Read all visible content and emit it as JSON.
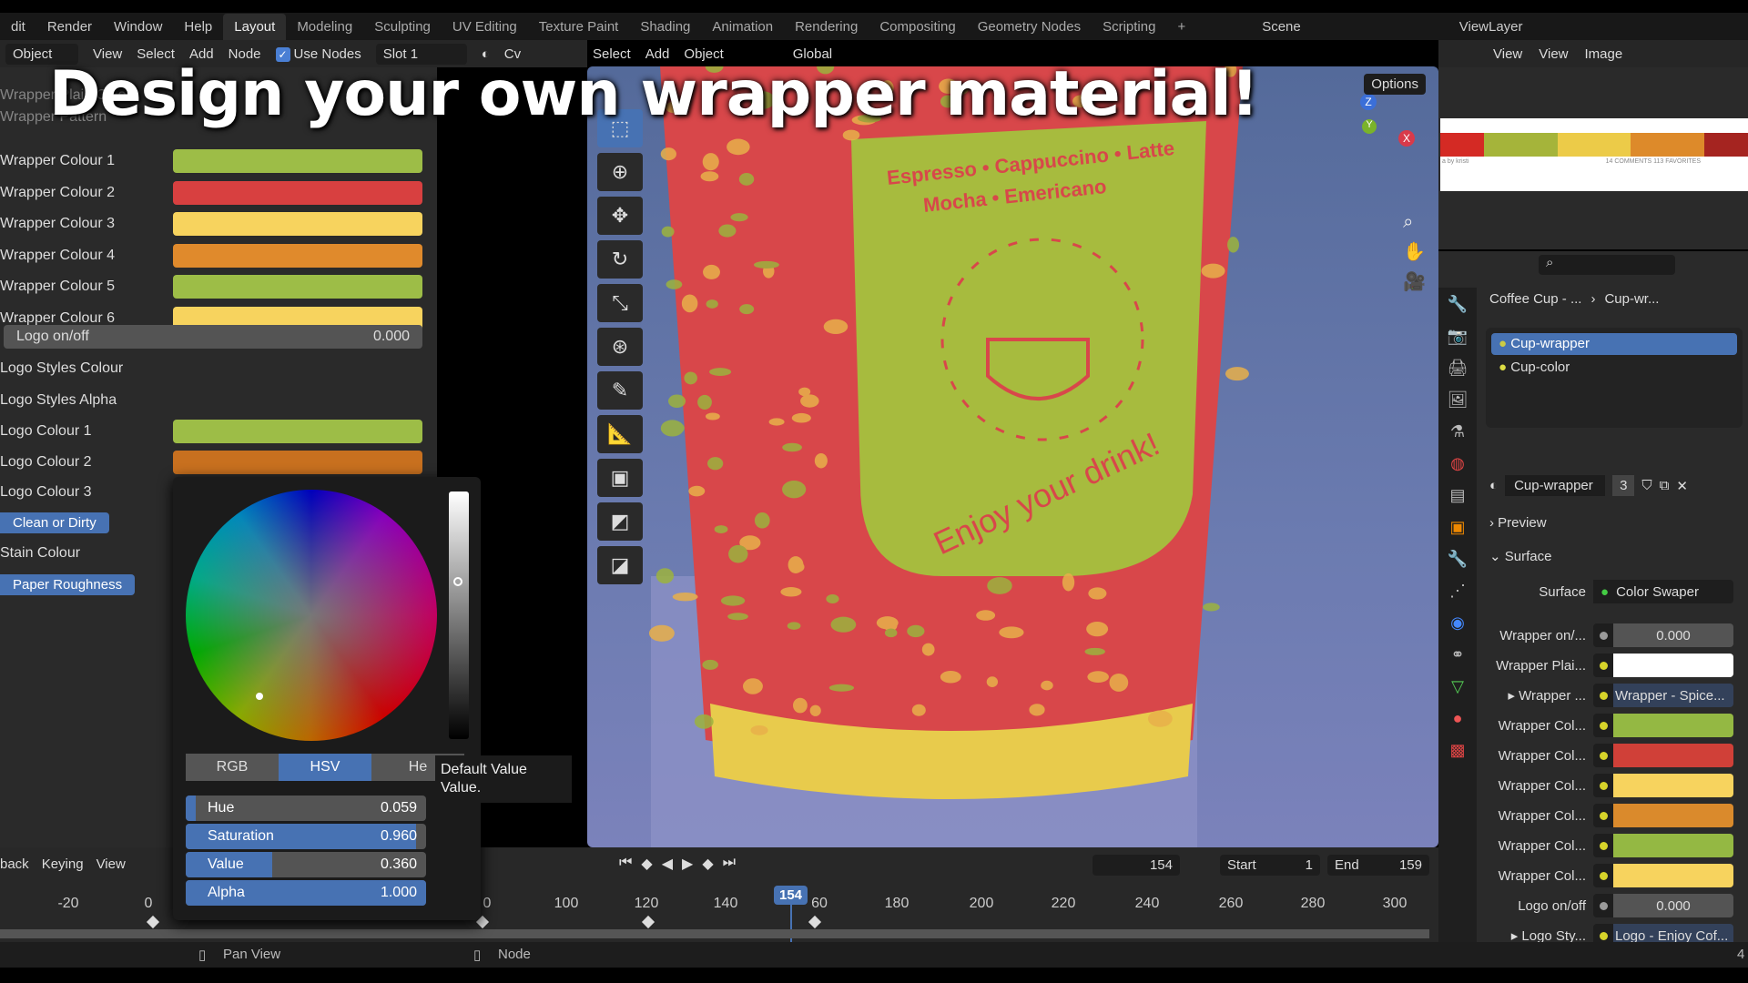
{
  "overlay_title": "Design your own wrapper material!",
  "topmenu": {
    "items": [
      "dit",
      "Render",
      "Window",
      "Help"
    ],
    "workspaces": [
      "Layout",
      "Modeling",
      "Sculpting",
      "UV Editing",
      "Texture Paint",
      "Shading",
      "Animation",
      "Rendering",
      "Compositing",
      "Geometry Nodes",
      "Scripting",
      "+"
    ],
    "active": "Layout",
    "scene": "Scene",
    "viewlayer": "ViewLayer"
  },
  "node_header": {
    "mode": "Object",
    "menus": [
      "View",
      "Select",
      "Add",
      "Node"
    ],
    "use_nodes": "Use Nodes",
    "slot": "Slot 1",
    "truncated": "Cv"
  },
  "view3d_header": {
    "menus": [
      "Select",
      "Add",
      "Object"
    ],
    "orientation": "Global",
    "options": "Options"
  },
  "left_panel": {
    "hidden_rows": [
      "Wrapper Plain Colour",
      "Wrapper Pattern"
    ],
    "rows": [
      {
        "label": "Wrapper Colour 1",
        "color": "#9dbd47"
      },
      {
        "label": "Wrapper Colour 2",
        "color": "#d84040"
      },
      {
        "label": "Wrapper Colour 3",
        "color": "#f7d35e"
      },
      {
        "label": "Wrapper Colour 4",
        "color": "#e08a2c"
      },
      {
        "label": "Wrapper Colour 5",
        "color": "#9dbd47"
      },
      {
        "label": "Wrapper Colour 6",
        "color": "#f7d35e"
      }
    ],
    "logo_onoff": {
      "label": "Logo on/off",
      "value": "0.000"
    },
    "logo_styles_colour": "Logo Styles Colour",
    "logo_styles_alpha": "Logo Styles Alpha",
    "logo_colours": [
      {
        "label": "Logo Colour 1",
        "color": "#9dbd47"
      },
      {
        "label": "Logo Colour 2",
        "color": "#c8701f"
      },
      {
        "label": "Logo Colour 3",
        "color": "#555555"
      }
    ],
    "clean_or_dirty": "Clean or Dirty",
    "stain_colour": "Stain Colour",
    "paper_roughness": "Paper Roughness"
  },
  "color_picker": {
    "tabs": [
      "RGB",
      "HSV",
      "He"
    ],
    "active_tab": "HSV",
    "hue": {
      "label": "Hue",
      "value": "0.059"
    },
    "saturation": {
      "label": "Saturation",
      "value": "0.960"
    },
    "value": {
      "label": "Value",
      "value": "0.360"
    },
    "alpha": {
      "label": "Alpha",
      "value": "1.000"
    },
    "tooltip": [
      "Default Value",
      "Value."
    ]
  },
  "viewport": {
    "cup_text_top": "Espresso • Cappuccino • Latte",
    "cup_text_mid": "Mocha • Emericano",
    "cup_text_bottom": "Enjoy your drink!",
    "axes": [
      "Z",
      "Y",
      "X"
    ]
  },
  "image_editor": {
    "menus": [
      "View",
      "View",
      "Image"
    ],
    "palette": [
      "#d42a24",
      "#a5b43a",
      "#eccb48",
      "#dd8a2a",
      "#a52420"
    ],
    "caption": "a by kristi",
    "stats": [
      {
        "n": "14",
        "l": "COMMENTS"
      },
      {
        "n": "113",
        "l": "FAVORITES"
      }
    ]
  },
  "properties": {
    "breadcrumb": [
      "Coffee Cup - ...",
      "Cup-wr..."
    ],
    "materials": [
      {
        "name": "Cup-wrapper",
        "selected": true
      },
      {
        "name": "Cup-color",
        "selected": false
      }
    ],
    "material_name": "Cup-wrapper",
    "users": "3",
    "preview": "Preview",
    "surface_section": "Surface",
    "surface_label": "Surface",
    "surface_value": "Color Swaper",
    "inputs": [
      {
        "label": "Wrapper on/...",
        "value": "0.000",
        "socket": "#9a9a9a"
      },
      {
        "label": "Wrapper Plai...",
        "color": "#ffffff",
        "socket": "#d6d32a"
      },
      {
        "label": "Wrapper ...",
        "value": "Wrapper - Spice...",
        "socket": "#d6d32a",
        "expand": true
      },
      {
        "label": "Wrapper Col...",
        "color": "#94b843",
        "socket": "#d6d32a"
      },
      {
        "label": "Wrapper Col...",
        "color": "#d04038",
        "socket": "#d6d32a"
      },
      {
        "label": "Wrapper Col...",
        "color": "#f7d35e",
        "socket": "#d6d32a"
      },
      {
        "label": "Wrapper Col...",
        "color": "#da8a2c",
        "socket": "#d6d32a"
      },
      {
        "label": "Wrapper Col...",
        "color": "#94b843",
        "socket": "#d6d32a"
      },
      {
        "label": "Wrapper Col...",
        "color": "#f7d35e",
        "socket": "#d6d32a"
      },
      {
        "label": "Logo on/off",
        "value": "0.000",
        "socket": "#9a9a9a"
      },
      {
        "label": "Logo Sty...",
        "value": "Logo - Enjoy Cof...",
        "socket": "#d6d32a",
        "expand": true
      }
    ]
  },
  "timeline": {
    "menus": [
      "back",
      "Keying",
      "View"
    ],
    "current_frame": "154",
    "start_label": "Start",
    "start": "1",
    "end_label": "End",
    "end": "159",
    "ticks": [
      "-20",
      "0",
      "0",
      "100",
      "120",
      "140",
      "60",
      "180",
      "200",
      "220",
      "240",
      "260",
      "280",
      "300"
    ]
  },
  "status": {
    "pan_view": "Pan View",
    "node": "Node",
    "version": "4"
  },
  "accent": "#4772b3"
}
